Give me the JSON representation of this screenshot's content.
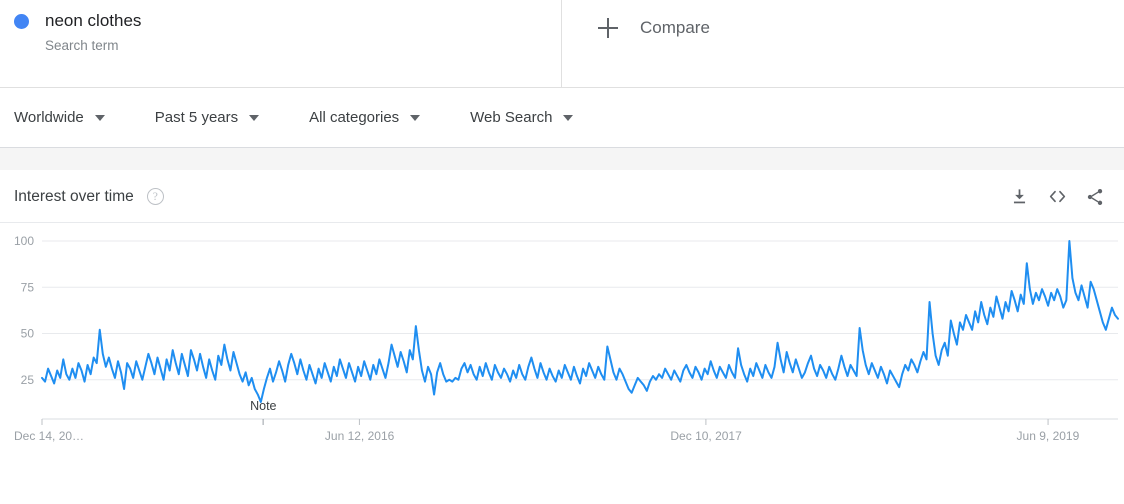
{
  "term": {
    "title": "neon clothes",
    "subtitle": "Search term",
    "dot_color": "#4285F4"
  },
  "compare": {
    "label": "Compare",
    "icon": "plus-icon"
  },
  "filters": [
    {
      "label": "Worldwide",
      "icon": "chevron-down-icon"
    },
    {
      "label": "Past 5 years",
      "icon": "chevron-down-icon"
    },
    {
      "label": "All categories",
      "icon": "chevron-down-icon"
    },
    {
      "label": "Web Search",
      "icon": "chevron-down-icon"
    }
  ],
  "chart_card": {
    "title": "Interest over time",
    "help_icon": "question-mark-icon",
    "help_glyph": "?",
    "actions": [
      {
        "name": "download-icon"
      },
      {
        "name": "embed-code-icon"
      },
      {
        "name": "share-icon"
      }
    ]
  },
  "chart_data": {
    "type": "line",
    "title": "Interest over time",
    "xlabel": "",
    "ylabel": "",
    "line_color": "#1f8ef1",
    "grid": true,
    "legend_position": "top",
    "ylim": [
      0,
      105
    ],
    "yticks": [
      25,
      50,
      75,
      100
    ],
    "ytick_labels": [
      "25",
      "50",
      "75",
      "100"
    ],
    "xtick_labels": [
      "Dec 14, 20…",
      "Jun 12, 2016",
      "Dec 10, 2017",
      "Jun 9, 2019"
    ],
    "xtick_positions": [
      0,
      0.295,
      0.617,
      0.935
    ],
    "annotations": [
      {
        "label": "Note",
        "x_fraction": 0.2055,
        "value": 13
      }
    ],
    "series": [
      {
        "name": "neon clothes",
        "color": "#1f8ef1",
        "values": [
          26,
          24,
          31,
          27,
          23,
          30,
          26,
          36,
          28,
          25,
          31,
          26,
          34,
          30,
          24,
          33,
          28,
          37,
          34,
          52,
          39,
          32,
          37,
          31,
          26,
          35,
          29,
          20,
          34,
          31,
          26,
          35,
          30,
          25,
          32,
          39,
          34,
          28,
          37,
          31,
          25,
          36,
          30,
          41,
          34,
          28,
          39,
          33,
          27,
          41,
          36,
          30,
          39,
          32,
          26,
          36,
          30,
          25,
          38,
          33,
          44,
          36,
          30,
          40,
          34,
          28,
          24,
          29,
          22,
          26,
          20,
          17,
          13,
          20,
          26,
          31,
          24,
          29,
          35,
          30,
          24,
          33,
          39,
          34,
          28,
          36,
          30,
          25,
          33,
          28,
          23,
          31,
          26,
          34,
          29,
          24,
          32,
          27,
          36,
          31,
          26,
          34,
          29,
          24,
          32,
          27,
          35,
          30,
          25,
          33,
          28,
          36,
          31,
          26,
          34,
          44,
          38,
          32,
          40,
          35,
          29,
          41,
          36,
          54,
          41,
          30,
          24,
          32,
          28,
          17,
          29,
          34,
          28,
          24,
          25,
          24,
          26,
          25,
          31,
          34,
          29,
          33,
          28,
          25,
          32,
          27,
          34,
          29,
          25,
          33,
          29,
          26,
          31,
          28,
          24,
          30,
          26,
          33,
          28,
          25,
          32,
          37,
          31,
          26,
          34,
          29,
          25,
          31,
          27,
          24,
          30,
          26,
          33,
          29,
          25,
          32,
          27,
          23,
          31,
          27,
          34,
          30,
          26,
          32,
          28,
          25,
          43,
          36,
          29,
          25,
          31,
          28,
          24,
          20,
          18,
          22,
          26,
          24,
          22,
          19,
          24,
          27,
          25,
          28,
          26,
          31,
          28,
          25,
          30,
          27,
          24,
          30,
          33,
          29,
          26,
          32,
          29,
          25,
          31,
          28,
          35,
          30,
          26,
          32,
          29,
          26,
          33,
          29,
          26,
          42,
          33,
          28,
          24,
          31,
          27,
          34,
          30,
          26,
          33,
          29,
          26,
          32,
          45,
          36,
          29,
          40,
          34,
          29,
          36,
          31,
          26,
          29,
          34,
          38,
          31,
          27,
          33,
          30,
          26,
          32,
          28,
          25,
          31,
          38,
          32,
          27,
          33,
          30,
          27,
          53,
          41,
          33,
          28,
          34,
          30,
          26,
          32,
          28,
          23,
          30,
          27,
          24,
          21,
          28,
          33,
          30,
          36,
          33,
          29,
          35,
          40,
          36,
          67,
          50,
          38,
          33,
          41,
          45,
          38,
          57,
          50,
          44,
          56,
          52,
          60,
          56,
          52,
          62,
          56,
          67,
          60,
          55,
          64,
          59,
          70,
          64,
          58,
          67,
          62,
          73,
          68,
          62,
          71,
          66,
          88,
          74,
          66,
          72,
          68,
          74,
          70,
          65,
          72,
          68,
          74,
          70,
          64,
          68,
          100,
          80,
          72,
          68,
          76,
          70,
          64,
          78,
          74,
          68,
          62,
          56,
          52,
          58,
          64,
          60,
          58
        ]
      }
    ]
  }
}
